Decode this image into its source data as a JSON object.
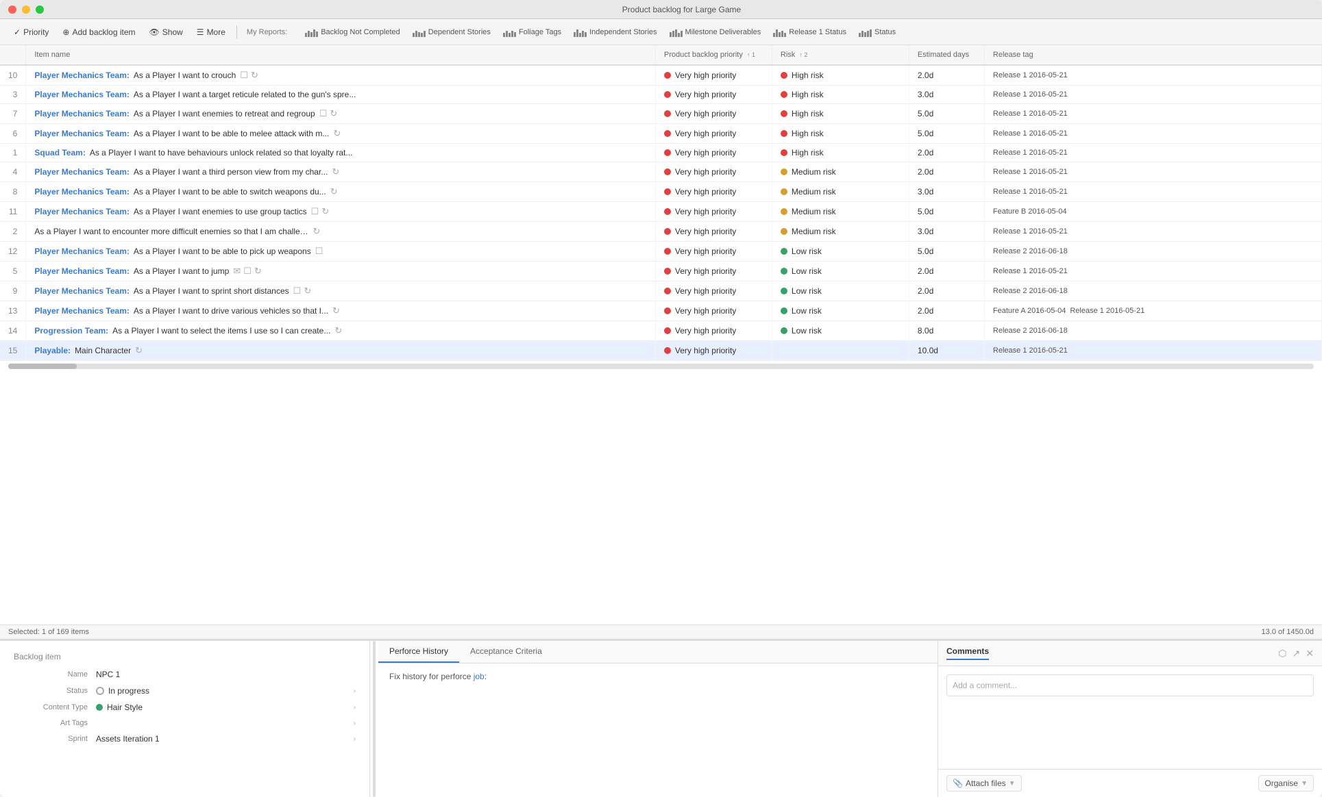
{
  "window": {
    "title": "Product backlog for Large Game"
  },
  "titlebar": {
    "buttons": [
      "close",
      "minimize",
      "maximize"
    ]
  },
  "toolbar": {
    "priority_label": "Priority",
    "add_label": "Add backlog item",
    "show_label": "Show",
    "more_label": "More",
    "my_reports_label": "My Reports:"
  },
  "reports": [
    {
      "id": "backlog-not-completed",
      "label": "Backlog Not Completed",
      "bars": [
        3,
        5,
        4,
        6,
        3
      ]
    },
    {
      "id": "dependent-stories",
      "label": "Dependent Stories",
      "bars": [
        3,
        5,
        4,
        3,
        5
      ]
    },
    {
      "id": "foliage-tags",
      "label": "Foliage Tags",
      "bars": [
        3,
        5,
        3,
        5,
        4
      ]
    },
    {
      "id": "independent-stories",
      "label": "Independent Stories",
      "bars": [
        4,
        6,
        3,
        5,
        4
      ]
    },
    {
      "id": "milestone-deliverables",
      "label": "Milestone Deliverables",
      "bars": [
        4,
        5,
        6,
        3,
        5
      ]
    },
    {
      "id": "release-1-status",
      "label": "Release 1 Status",
      "bars": [
        3,
        6,
        4,
        5,
        3
      ]
    },
    {
      "id": "status",
      "label": "Status",
      "bars": [
        3,
        5,
        4,
        5,
        6
      ]
    }
  ],
  "columns": {
    "num": "#",
    "item_name": "Item name",
    "priority": "Product backlog priority",
    "priority_sort": "1",
    "risk": "Risk",
    "risk_sort": "2",
    "est_days": "Estimated days",
    "release_tag": "Release tag"
  },
  "rows": [
    {
      "num": "10",
      "team": "Player Mechanics Team:",
      "text": "As a Player I want to crouch",
      "icons": [
        "checkbox",
        "spinner"
      ],
      "priority_dot": "red",
      "priority": "Very high priority",
      "risk_dot": "red",
      "risk": "High risk",
      "est": "2.0d",
      "tags": [
        {
          "label": "Release 1",
          "date": "2016-05-21"
        }
      ],
      "selected": false
    },
    {
      "num": "3",
      "team": "Player Mechanics Team:",
      "text": "As a Player I want a target reticule related to the gun's spre...",
      "icons": [],
      "priority_dot": "red",
      "priority": "Very high priority",
      "risk_dot": "red",
      "risk": "High risk",
      "est": "3.0d",
      "tags": [
        {
          "label": "Release 1",
          "date": "2016-05-21"
        }
      ],
      "selected": false
    },
    {
      "num": "7",
      "team": "Player Mechanics Team:",
      "text": "As a Player I want enemies to retreat and regroup",
      "icons": [
        "checkbox",
        "spinner"
      ],
      "priority_dot": "red",
      "priority": "Very high priority",
      "risk_dot": "red",
      "risk": "High risk",
      "est": "5.0d",
      "tags": [
        {
          "label": "Release 1",
          "date": "2016-05-21"
        }
      ],
      "selected": false
    },
    {
      "num": "6",
      "team": "Player Mechanics Team:",
      "text": "As a Player I want to be able to melee attack with m...",
      "icons": [
        "spinner"
      ],
      "priority_dot": "red",
      "priority": "Very high priority",
      "risk_dot": "red",
      "risk": "High risk",
      "est": "5.0d",
      "tags": [
        {
          "label": "Release 1",
          "date": "2016-05-21"
        }
      ],
      "selected": false
    },
    {
      "num": "1",
      "team": "Squad Team:",
      "text": "As a Player I want to have behaviours unlock related so that loyalty rat...",
      "icons": [],
      "priority_dot": "red",
      "priority": "Very high priority",
      "risk_dot": "red",
      "risk": "High risk",
      "est": "2.0d",
      "tags": [
        {
          "label": "Release 1",
          "date": "2016-05-21"
        }
      ],
      "selected": false
    },
    {
      "num": "4",
      "team": "Player Mechanics Team:",
      "text": "As a Player I want a third person view from my char...",
      "icons": [
        "spinner"
      ],
      "priority_dot": "red",
      "priority": "Very high priority",
      "risk_dot": "yellow",
      "risk": "Medium risk",
      "est": "2.0d",
      "tags": [
        {
          "label": "Release 1",
          "date": "2016-05-21"
        }
      ],
      "selected": false
    },
    {
      "num": "8",
      "team": "Player Mechanics Team:",
      "text": "As a Player I want to be able to switch weapons du...",
      "icons": [
        "spinner"
      ],
      "priority_dot": "red",
      "priority": "Very high priority",
      "risk_dot": "yellow",
      "risk": "Medium risk",
      "est": "3.0d",
      "tags": [
        {
          "label": "Release 1",
          "date": "2016-05-21"
        }
      ],
      "selected": false
    },
    {
      "num": "11",
      "team": "Player Mechanics Team:",
      "text": "As a Player I want enemies to use group tactics",
      "icons": [
        "checkbox",
        "spinner"
      ],
      "priority_dot": "red",
      "priority": "Very high priority",
      "risk_dot": "yellow",
      "risk": "Medium risk",
      "est": "5.0d",
      "tags": [
        {
          "label": "Feature B",
          "date": "2016-05-04"
        }
      ],
      "selected": false
    },
    {
      "num": "2",
      "team": "",
      "text": "As a Player I want to encounter more difficult enemies so that I am challeng...",
      "icons": [
        "spinner"
      ],
      "priority_dot": "red",
      "priority": "Very high priority",
      "risk_dot": "yellow",
      "risk": "Medium risk",
      "est": "3.0d",
      "tags": [
        {
          "label": "Release 1",
          "date": "2016-05-21"
        }
      ],
      "selected": false
    },
    {
      "num": "12",
      "team": "Player Mechanics Team:",
      "text": "As a Player I want to be able to pick up weapons",
      "icons": [
        "checkbox"
      ],
      "priority_dot": "red",
      "priority": "Very high priority",
      "risk_dot": "green",
      "risk": "Low risk",
      "est": "5.0d",
      "tags": [
        {
          "label": "Release 2",
          "date": "2016-06-18"
        }
      ],
      "selected": false
    },
    {
      "num": "5",
      "team": "Player Mechanics Team:",
      "text": "As a Player I want to jump",
      "icons": [
        "mail",
        "checkbox",
        "spinner"
      ],
      "priority_dot": "red",
      "priority": "Very high priority",
      "risk_dot": "green",
      "risk": "Low risk",
      "est": "2.0d",
      "tags": [
        {
          "label": "Release 1",
          "date": "2016-05-21"
        }
      ],
      "selected": false
    },
    {
      "num": "9",
      "team": "Player Mechanics Team:",
      "text": "As a Player I want to sprint short distances",
      "icons": [
        "checkbox",
        "spinner"
      ],
      "priority_dot": "red",
      "priority": "Very high priority",
      "risk_dot": "green",
      "risk": "Low risk",
      "est": "2.0d",
      "tags": [
        {
          "label": "Release 2",
          "date": "2016-06-18"
        }
      ],
      "selected": false
    },
    {
      "num": "13",
      "team": "Player Mechanics Team:",
      "text": "As a Player I want to drive various vehicles so that I...",
      "icons": [
        "spinner"
      ],
      "priority_dot": "red",
      "priority": "Very high priority",
      "risk_dot": "green",
      "risk": "Low risk",
      "est": "2.0d",
      "tags": [
        {
          "label": "Feature A",
          "date": "2016-05-04"
        },
        {
          "label": "Release 1",
          "date": "2016-05-21"
        }
      ],
      "selected": false
    },
    {
      "num": "14",
      "team": "Progression Team:",
      "text": "As a Player I want to select the items I use so I can create...",
      "icons": [
        "spinner"
      ],
      "priority_dot": "red",
      "priority": "Very high priority",
      "risk_dot": "green",
      "risk": "Low risk",
      "est": "8.0d",
      "tags": [
        {
          "label": "Release 2",
          "date": "2016-06-18"
        }
      ],
      "selected": false
    },
    {
      "num": "15",
      "team": "Playable:",
      "text": "Main Character",
      "icons": [
        "spinner"
      ],
      "priority_dot": "red",
      "priority": "Very high priority",
      "risk_dot": null,
      "risk": "",
      "est": "10.0d",
      "tags": [
        {
          "label": "Release 1",
          "date": "2016-05-21"
        }
      ],
      "selected": true
    }
  ],
  "status_bar": {
    "selected": "Selected: 1 of 169 items",
    "total": "13.0 of 1450.0d"
  },
  "detail_panel": {
    "title": "Backlog item",
    "fields": [
      {
        "label": "Name",
        "value": "NPC 1",
        "type": "text",
        "has_arrow": false
      },
      {
        "label": "Status",
        "value": "In progress",
        "type": "status",
        "has_arrow": true
      },
      {
        "label": "Content Type",
        "value": "Hair Style",
        "type": "content",
        "has_arrow": true
      },
      {
        "label": "Art Tags",
        "value": "",
        "type": "text",
        "has_arrow": true
      },
      {
        "label": "Sprint",
        "value": "Assets Iteration 1",
        "type": "text",
        "has_arrow": true
      }
    ]
  },
  "tabs": [
    {
      "id": "perforce",
      "label": "Perforce History",
      "active": true
    },
    {
      "id": "acceptance",
      "label": "Acceptance Criteria",
      "active": false
    }
  ],
  "perforce": {
    "text": "Fix history for perforce ",
    "link_text": "job",
    "link_suffix": ":"
  },
  "comments": {
    "title": "Comments",
    "placeholder": "Add a comment...",
    "attach_label": "Attach files",
    "organise_label": "Organise"
  }
}
